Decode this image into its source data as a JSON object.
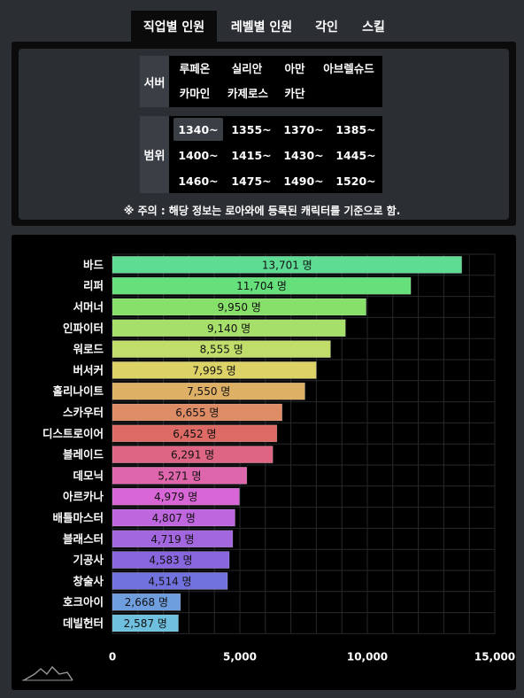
{
  "tabs": [
    {
      "label": "직업별 인원",
      "active": true
    },
    {
      "label": "레벨별 인원",
      "active": false
    },
    {
      "label": "각인",
      "active": false
    },
    {
      "label": "스킬",
      "active": false
    }
  ],
  "filters": {
    "server": {
      "label": "서버",
      "options": [
        "루페온",
        "실리안",
        "아만",
        "아브렐슈드",
        "카마인",
        "카제로스",
        "카단"
      ],
      "selected": null
    },
    "range": {
      "label": "범위",
      "options": [
        "1340~",
        "1355~",
        "1370~",
        "1385~",
        "1400~",
        "1415~",
        "1430~",
        "1445~",
        "1460~",
        "1475~",
        "1490~",
        "1520~"
      ],
      "selected": "1340~"
    },
    "note": "※ 주의 : 해당 정보는 로아와에 등록된 캐릭터를 기준으로 함."
  },
  "chart_data": {
    "type": "bar",
    "orientation": "horizontal",
    "categories": [
      "바드",
      "리퍼",
      "서머너",
      "인파이터",
      "워로드",
      "버서커",
      "홀리나이트",
      "스카우터",
      "디스트로이어",
      "블레이드",
      "데모닉",
      "아르카나",
      "배틀마스터",
      "블래스터",
      "기공사",
      "창술사",
      "호크아이",
      "데빌헌터"
    ],
    "values": [
      13701,
      11704,
      9950,
      9140,
      8555,
      7995,
      7550,
      6655,
      6452,
      6291,
      5271,
      4979,
      4807,
      4719,
      4583,
      4514,
      2668,
      2587
    ],
    "value_labels": [
      "13,701 명",
      "11,704 명",
      "9,950 명",
      "9,140 명",
      "8,555 명",
      "7,995 명",
      "7,550 명",
      "6,655 명",
      "6,452 명",
      "6,291 명",
      "5,271 명",
      "4,979 명",
      "4,807 명",
      "4,719 명",
      "4,583 명",
      "4,514 명",
      "2,668 명",
      "2,587 명"
    ],
    "colors": [
      "#5edc94",
      "#66e07a",
      "#86e06a",
      "#a6e06a",
      "#c2de6a",
      "#dcd266",
      "#deb066",
      "#de8c66",
      "#de6a66",
      "#de6684",
      "#de66ac",
      "#d866d6",
      "#be66de",
      "#a266de",
      "#8866de",
      "#7272de",
      "#6e9ede",
      "#6ec0de"
    ],
    "xticks": [
      0,
      5000,
      10000,
      15000
    ],
    "xtick_labels": [
      "0",
      "5,000",
      "10,000",
      "15,000"
    ],
    "xlim": [
      0,
      15000
    ],
    "grid": true,
    "title": "",
    "xlabel": "",
    "ylabel": ""
  }
}
